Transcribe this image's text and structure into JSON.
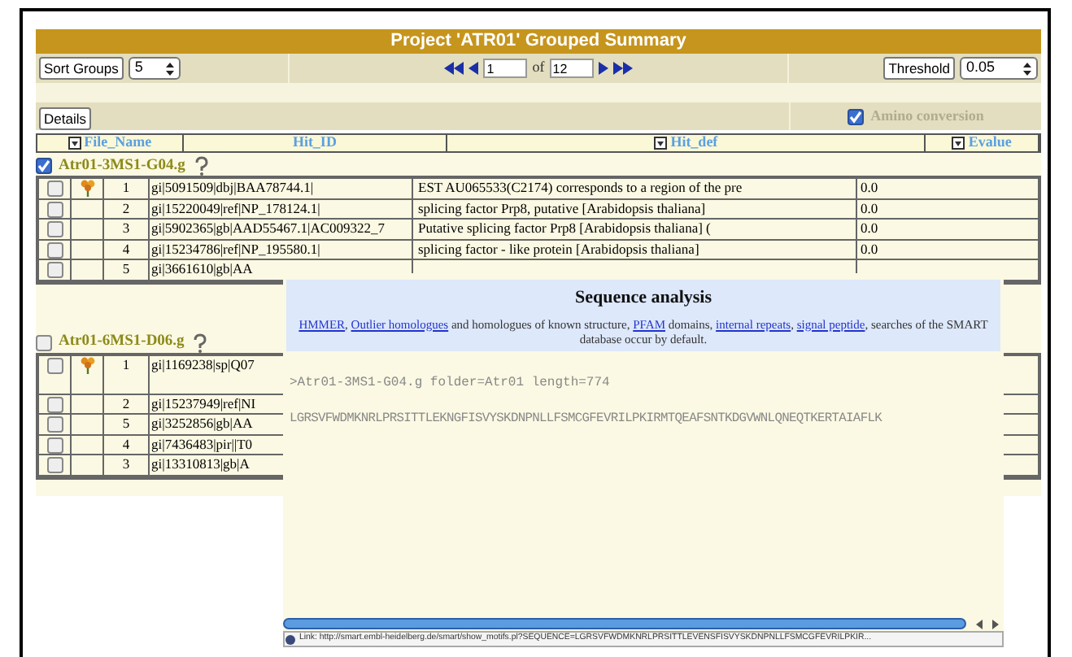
{
  "title": "Project 'ATR01' Grouped Summary",
  "toolbar": {
    "sort_button": "Sort Groups",
    "sort_value": "5",
    "page": "1",
    "of_label": "of",
    "total": "12",
    "threshold_button": "Threshold",
    "threshold_value": "0.05"
  },
  "details_button": "Details",
  "amino_conversion": {
    "label": "Amino conversion",
    "checked": true
  },
  "columns": [
    {
      "label": "File_Name",
      "sortable": true
    },
    {
      "label": "Hit_ID",
      "sortable": false
    },
    {
      "label": "Hit_def",
      "sortable": true
    },
    {
      "label": "Evalue",
      "sortable": true
    }
  ],
  "groups": [
    {
      "name": "Atr01-3MS1-G04.g",
      "checked": true,
      "rows": [
        {
          "checked": false,
          "flagged": true,
          "rank": "1",
          "hit_id": "gi|5091509|dbj|BAA78744.1|",
          "hit_def": "EST AU065533(C2174) corresponds to a region of the pre",
          "evalue": "0.0"
        },
        {
          "checked": false,
          "flagged": false,
          "rank": "2",
          "hit_id": "gi|15220049|ref|NP_178124.1|",
          "hit_def": "splicing factor Prp8, putative [Arabidopsis thaliana]",
          "evalue": "0.0"
        },
        {
          "checked": false,
          "flagged": false,
          "rank": "3",
          "hit_id": "gi|5902365|gb|AAD55467.1|AC009322_7",
          "hit_def": "Putative splicing factor Prp8 [Arabidopsis thaliana] (",
          "evalue": "0.0"
        },
        {
          "checked": false,
          "flagged": false,
          "rank": "4",
          "hit_id": "gi|15234786|ref|NP_195580.1|",
          "hit_def": "splicing factor - like protein [Arabidopsis thaliana]",
          "evalue": "0.0"
        },
        {
          "checked": false,
          "flagged": false,
          "rank": "5",
          "hit_id": "gi|3661610|gb|AA"
        }
      ]
    },
    {
      "name": "Atr01-6MS1-D06.g",
      "checked": false,
      "rows": [
        {
          "checked": false,
          "flagged": true,
          "rank": "1",
          "hit_id": "gi|1169238|sp|Q07"
        },
        {
          "checked": false,
          "flagged": false,
          "rank": "2",
          "hit_id": "gi|15237949|ref|NI"
        },
        {
          "checked": false,
          "flagged": false,
          "rank": "5",
          "hit_id": "gi|3252856|gb|AA"
        },
        {
          "checked": false,
          "flagged": false,
          "rank": "4",
          "hit_id": "gi|7436483|pir||T0"
        },
        {
          "checked": false,
          "flagged": false,
          "rank": "3",
          "hit_id": "gi|13310813|gb|A"
        }
      ]
    }
  ],
  "popup": {
    "title": "Sequence analysis",
    "intro": [
      {
        "text": "HMMER",
        "link": true
      },
      {
        "text": ", ",
        "link": false
      },
      {
        "text": "Outlier homologues",
        "link": true
      },
      {
        "text": " and homologues of known structure, ",
        "link": false
      },
      {
        "text": "PFAM",
        "link": true
      },
      {
        "text": " domains, ",
        "link": false
      },
      {
        "text": "internal repeats",
        "link": true
      },
      {
        "text": ", ",
        "link": false
      },
      {
        "text": "signal peptide",
        "link": true
      },
      {
        "text": ", searches of the SMART database occur by default.",
        "link": false
      }
    ],
    "header_line": ">Atr01-3MS1-G04.g folder=Atr01 length=774",
    "sequence": "LGRSVFWDMKNRLPRSITTLEKNGFISVYSKDNPNLLFSMCGFEVRILPKIRMTQEAFSNTKDGVWNLQNEQTKERTAIAFLK",
    "status_link": "Link: http://smart.embl-heidelberg.de/smart/show_motifs.pl?SEQUENCE=LGRSVFWDMKNRLPRSITTLEVENSFISVYSKDNPNLLFSMCGFEVRILPKIR..."
  }
}
